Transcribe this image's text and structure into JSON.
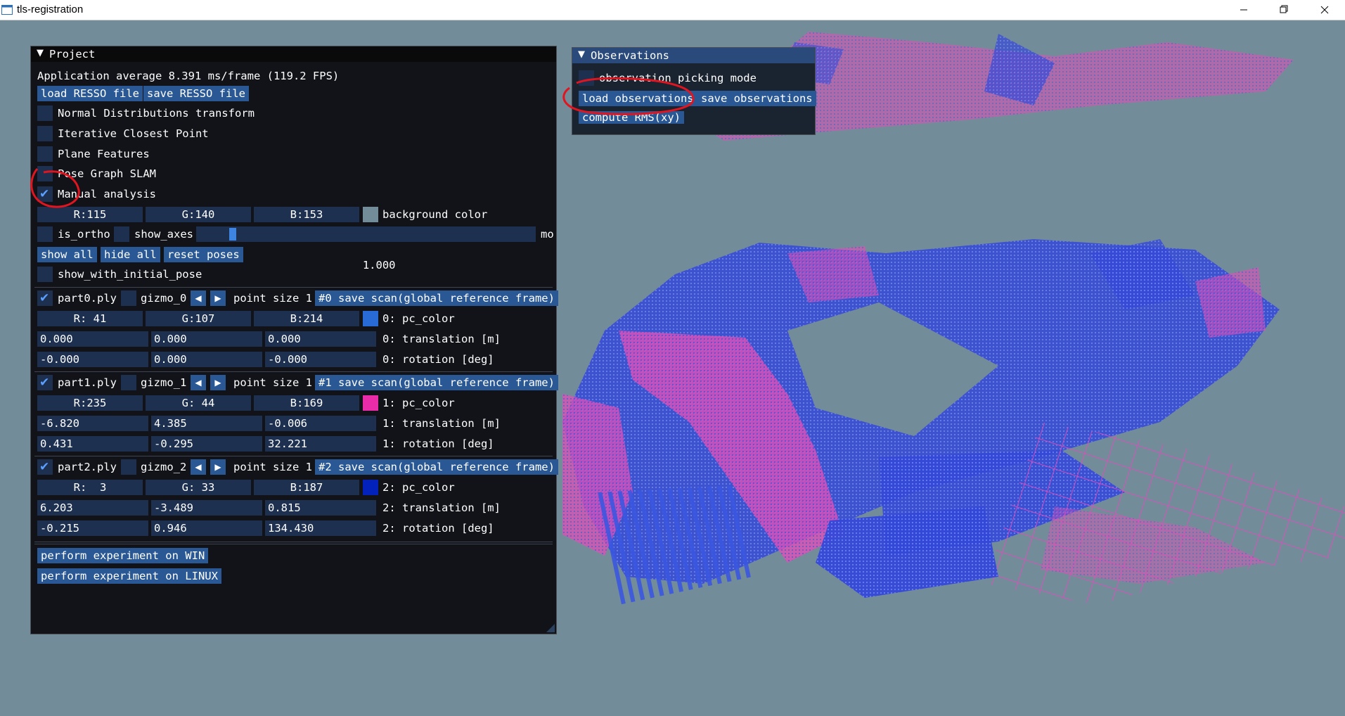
{
  "window": {
    "title": "tls-registration"
  },
  "project": {
    "title": "Project",
    "fps_text": "Application average 8.391 ms/frame (119.2 FPS)",
    "load_resso": "load RESSO file",
    "save_resso": "save RESSO file",
    "options": [
      {
        "label": "Normal Distributions transform",
        "checked": false
      },
      {
        "label": "Iterative Closest Point",
        "checked": false
      },
      {
        "label": "Plane Features",
        "checked": false
      },
      {
        "label": "Pose Graph SLAM",
        "checked": false
      },
      {
        "label": "Manual analysis",
        "checked": true
      }
    ],
    "bg": {
      "r": "R:115",
      "g": "G:140",
      "b": "B:153",
      "label": "background color",
      "swatch": "#738c99"
    },
    "is_ortho": "is_ortho",
    "show_axes": "show_axes",
    "slider_value": "1.000",
    "slider_fraction": 0.08,
    "slider_label": "mo",
    "show_all": "show all",
    "hide_all": "hide all",
    "reset_poses": "reset poses",
    "show_with_initial_pose": "show_with_initial_pose",
    "parts": [
      {
        "name": "part0.ply",
        "checked": true,
        "gizmo": "gizmo_0",
        "point_size": "point size 1",
        "save": "#0 save scan(global reference frame)",
        "r": "R: 41",
        "g": "G:107",
        "b": "B:214",
        "color": "#296bd6",
        "color_label": "0: pc_color",
        "translation": [
          "0.000",
          "0.000",
          "0.000"
        ],
        "translation_label": "0: translation [m]",
        "rotation": [
          "-0.000",
          "0.000",
          "-0.000"
        ],
        "rotation_label": "0: rotation [deg]"
      },
      {
        "name": "part1.ply",
        "checked": true,
        "gizmo": "gizmo_1",
        "point_size": "point size 1",
        "save": "#1 save scan(global reference frame)",
        "r": "R:235",
        "g": "G: 44",
        "b": "B:169",
        "color": "#eb2ca9",
        "color_label": "1: pc_color",
        "translation": [
          "-6.820",
          "4.385",
          "-0.006"
        ],
        "translation_label": "1: translation [m]",
        "rotation": [
          "0.431",
          "-0.295",
          "32.221"
        ],
        "rotation_label": "1: rotation [deg]"
      },
      {
        "name": "part2.ply",
        "checked": true,
        "gizmo": "gizmo_2",
        "point_size": "point size 1",
        "save": "#2 save scan(global reference frame)",
        "r": "R:  3",
        "g": "G: 33",
        "b": "B:187",
        "color": "#0321bb",
        "color_label": "2: pc_color",
        "translation": [
          "6.203",
          "-3.489",
          "0.815"
        ],
        "translation_label": "2: translation [m]",
        "rotation": [
          "-0.215",
          "0.946",
          "134.430"
        ],
        "rotation_label": "2: rotation [deg]"
      }
    ],
    "experiment_win": "perform experiment on WIN",
    "experiment_linux": "perform experiment on LINUX"
  },
  "observations": {
    "title": "Observations",
    "picking_mode": "observation picking mode",
    "load": "load observations",
    "save": "save observations",
    "compute": "compute RMS(xy)"
  },
  "colors": {
    "background": "#738c99",
    "panel": "#111318",
    "button": "#2a5894",
    "frame": "#1d3050",
    "annotation": "#e0151f"
  },
  "icons": {
    "collapse": "triangle-down-icon",
    "check": "checkmark-icon",
    "arrow_left": "arrow-left-icon",
    "arrow_right": "arrow-right-icon",
    "window_controls": [
      "minimize-icon",
      "restore-icon",
      "close-icon"
    ]
  }
}
